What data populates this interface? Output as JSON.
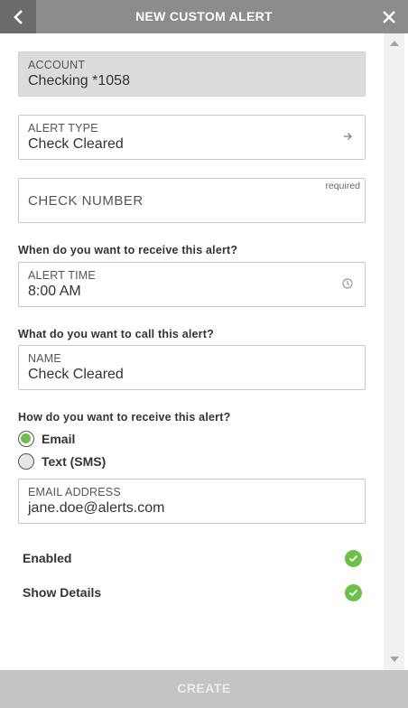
{
  "header": {
    "title": "NEW CUSTOM ALERT",
    "back_icon": "chevron-left-icon",
    "close_icon": "close-icon"
  },
  "form": {
    "account": {
      "label": "ACCOUNT",
      "value": "Checking *1058",
      "disabled": true
    },
    "alert_type": {
      "label": "ALERT TYPE",
      "value": "Check Cleared",
      "icon": "arrow-right-icon"
    },
    "check_number": {
      "placeholder": "CHECK NUMBER",
      "required_text": "required",
      "value": ""
    },
    "time_question": "When do you want to receive this alert?",
    "alert_time": {
      "label": "ALERT TIME",
      "value": "8:00 AM",
      "icon": "clock-icon"
    },
    "name_question": "What do you want to call this alert?",
    "name": {
      "label": "NAME",
      "value": "Check Cleared"
    },
    "delivery_question": "How do you want to receive this alert?",
    "delivery_options": [
      {
        "label": "Email",
        "selected": true
      },
      {
        "label": "Text (SMS)",
        "selected": false
      }
    ],
    "email": {
      "label": "EMAIL ADDRESS",
      "value": "jane.doe@alerts.com"
    },
    "toggles": [
      {
        "label": "Enabled",
        "on": true
      },
      {
        "label": "Show Details",
        "on": true
      }
    ]
  },
  "footer": {
    "create_label": "CREATE"
  },
  "colors": {
    "header_bg": "#8c8c8c",
    "back_bg": "#6b6b6b",
    "accent_green": "#6cc04a",
    "footer_bg": "#c4c4c4",
    "disabled_field": "#dcdcdc"
  }
}
